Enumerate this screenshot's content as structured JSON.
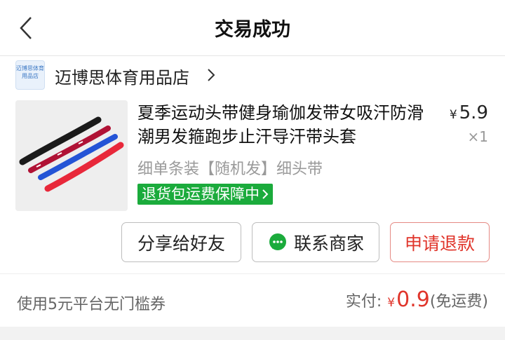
{
  "nav": {
    "title": "交易成功"
  },
  "shop": {
    "name": "迈博思体育用品店",
    "logo_text": "迈博思体育用品店"
  },
  "product": {
    "title": "夏季运动头带健身瑜伽发带女吸汗防滑潮男发箍跑步止汗导汗带头套",
    "price_currency": "¥",
    "price": "5.9",
    "quantity": "×1",
    "sku": "细单条装【随机发】细头带",
    "guarantee": "退货包运费保障中"
  },
  "actions": {
    "share": "分享给好友",
    "contact": "联系商家",
    "refund": "申请退款"
  },
  "footer": {
    "coupon": "使用5元平台无门槛券",
    "paid_label": "实付:",
    "paid_currency": "¥",
    "paid_amount": "0.9",
    "shipping_note": "(免运费)"
  },
  "colors": {
    "accent_red": "#e0352b",
    "guarantee_green": "#1bab3c"
  }
}
